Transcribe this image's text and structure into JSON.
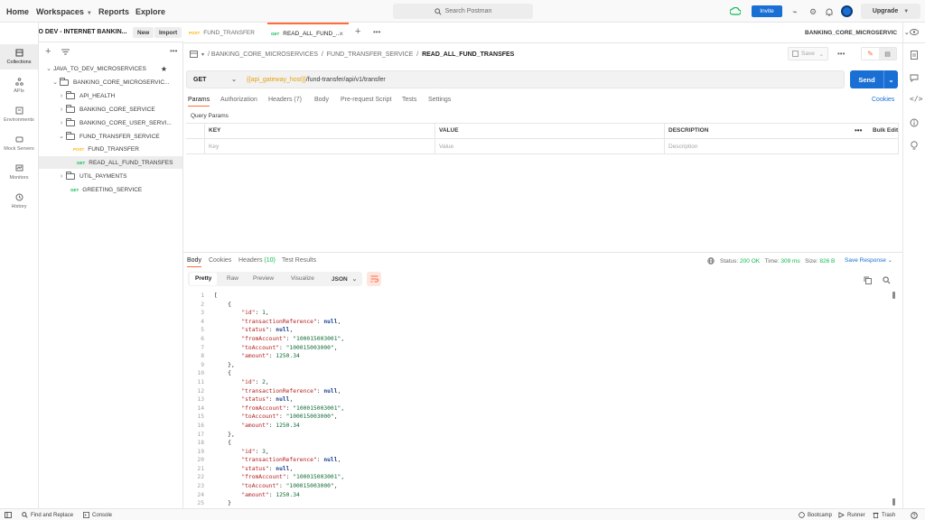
{
  "topbar": {
    "nav": [
      "Home",
      "Workspaces",
      "Reports",
      "Explore"
    ],
    "search_placeholder": "Search Postman",
    "invite_label": "Invite",
    "upgrade_label": "Upgrade"
  },
  "workspace": {
    "title": "JAVA TO DEV - INTERNET BANKIN...",
    "new_label": "New",
    "import_label": "Import"
  },
  "rail": [
    "Collections",
    "APIs",
    "Environments",
    "Mock Servers",
    "Monitors",
    "History"
  ],
  "tree": {
    "collection": "JAVA_TO_DEV_MICROSERVICES",
    "items": [
      {
        "label": "BANKING_CORE_MICROSERVIC..."
      },
      {
        "label": "API_HEALTH"
      },
      {
        "label": "BANKING_CORE_SERVICE"
      },
      {
        "label": "BANKING_CORE_USER_SERVI..."
      },
      {
        "label": "FUND_TRANSFER_SERVICE"
      },
      {
        "label": "FUND_TRANSFER",
        "method": "POST"
      },
      {
        "label": "READ_ALL_FUND_TRANSFES",
        "method": "GET"
      },
      {
        "label": "UTIL_PAYMENTS"
      },
      {
        "label": "GREETING_SERVICE",
        "method": "GET"
      }
    ]
  },
  "tabs": [
    {
      "method": "POST",
      "label": "FUND_TRANSFER"
    },
    {
      "method": "GET",
      "label": "READ_ALL_FUND_..."
    }
  ],
  "environment": "BANKING_CORE_MICROSERVIC",
  "breadcrumb": [
    "BANKING_CORE_MICROSERVICES",
    "FUND_TRANSFER_SERVICE",
    "READ_ALL_FUND_TRANSFES"
  ],
  "save_label": "Save",
  "request": {
    "method": "GET",
    "url_var": "{{api_gateway_host}}",
    "url_path": "/fund-transfer/api/v1/transfer",
    "send_label": "Send",
    "tabs": [
      "Params",
      "Authorization",
      "Headers (7)",
      "Body",
      "Pre-request Script",
      "Tests",
      "Settings"
    ],
    "cookies_label": "Cookies",
    "query_params_label": "Query Params",
    "columns": [
      "KEY",
      "VALUE",
      "DESCRIPTION"
    ],
    "bulk_edit": "Bulk Edit",
    "placeholders": [
      "Key",
      "Value",
      "Description"
    ]
  },
  "response": {
    "tabs": [
      "Body",
      "Cookies",
      "Headers",
      "(10)",
      "Test Results"
    ],
    "status_label": "Status:",
    "status_value": "200 OK",
    "time_label": "Time:",
    "time_value": "309 ms",
    "size_label": "Size:",
    "size_value": "826 B",
    "save_response": "Save Response",
    "formats": [
      "Pretty",
      "Raw",
      "Preview",
      "Visualize"
    ],
    "json_label": "JSON"
  },
  "code_lines": [
    "[",
    "    {",
    "        \"id\": 1,",
    "        \"transactionReference\": null,",
    "        \"status\": null,",
    "        \"fromAccount\": \"100015003001\",",
    "        \"toAccount\": \"100015003000\",",
    "        \"amount\": 1250.34",
    "    },",
    "    {",
    "        \"id\": 2,",
    "        \"transactionReference\": null,",
    "        \"status\": null,",
    "        \"fromAccount\": \"100015003001\",",
    "        \"toAccount\": \"100015003000\",",
    "        \"amount\": 1250.34",
    "    },",
    "    {",
    "        \"id\": 3,",
    "        \"transactionReference\": null,",
    "        \"status\": null,",
    "        \"fromAccount\": \"100015003001\",",
    "        \"toAccount\": \"100015003000\",",
    "        \"amount\": 1250.34",
    "    }"
  ],
  "statusbar": {
    "find_replace": "Find and Replace",
    "console": "Console",
    "bootcamp": "Bootcamp",
    "runner": "Runner",
    "trash": "Trash"
  },
  "colors": {
    "accent": "#ff6c37",
    "primary": "#1a6fd4",
    "get": "#0cbb52",
    "post": "#ffb400"
  }
}
